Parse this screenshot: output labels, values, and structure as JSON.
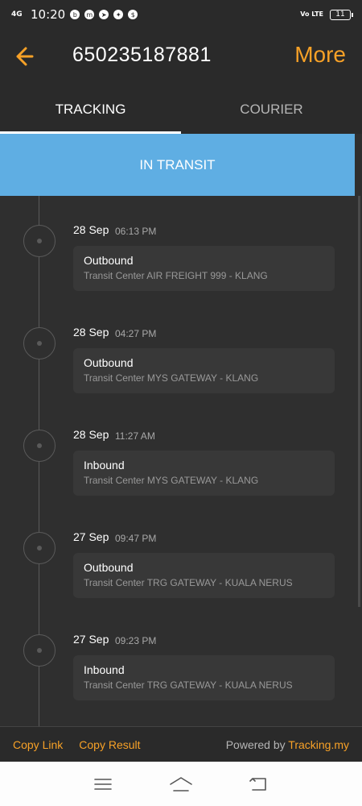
{
  "status_bar": {
    "network": "4G",
    "time": "10:20",
    "volte": "Vo LTE",
    "battery": "11"
  },
  "header": {
    "title": "650235187881",
    "more_label": "More"
  },
  "tabs": [
    {
      "label": "TRACKING",
      "active": true
    },
    {
      "label": "COURIER",
      "active": false
    }
  ],
  "banner": {
    "label": "IN TRANSIT",
    "color": "#5faee3"
  },
  "events": [
    {
      "date": "28 Sep",
      "time": "06:13 PM",
      "status": "Outbound",
      "location": "Transit Center AIR FREIGHT 999 - KLANG"
    },
    {
      "date": "28 Sep",
      "time": "04:27 PM",
      "status": "Outbound",
      "location": "Transit Center MYS GATEWAY - KLANG"
    },
    {
      "date": "28 Sep",
      "time": "11:27 AM",
      "status": "Inbound",
      "location": "Transit Center MYS GATEWAY - KLANG"
    },
    {
      "date": "27 Sep",
      "time": "09:47 PM",
      "status": "Outbound",
      "location": "Transit Center TRG GATEWAY - KUALA NERUS"
    },
    {
      "date": "27 Sep",
      "time": "09:23 PM",
      "status": "Inbound",
      "location": "Transit Center TRG GATEWAY - KUALA NERUS"
    }
  ],
  "footer": {
    "copy_link": "Copy Link",
    "copy_result": "Copy Result",
    "powered_by": "Powered by ",
    "brand": "Tracking.my"
  },
  "navigation": {
    "icons": [
      "menu-icon",
      "home-icon",
      "back-icon"
    ]
  },
  "colors": {
    "accent": "#f7a127",
    "background": "#2f2f2f",
    "card": "#383838"
  }
}
